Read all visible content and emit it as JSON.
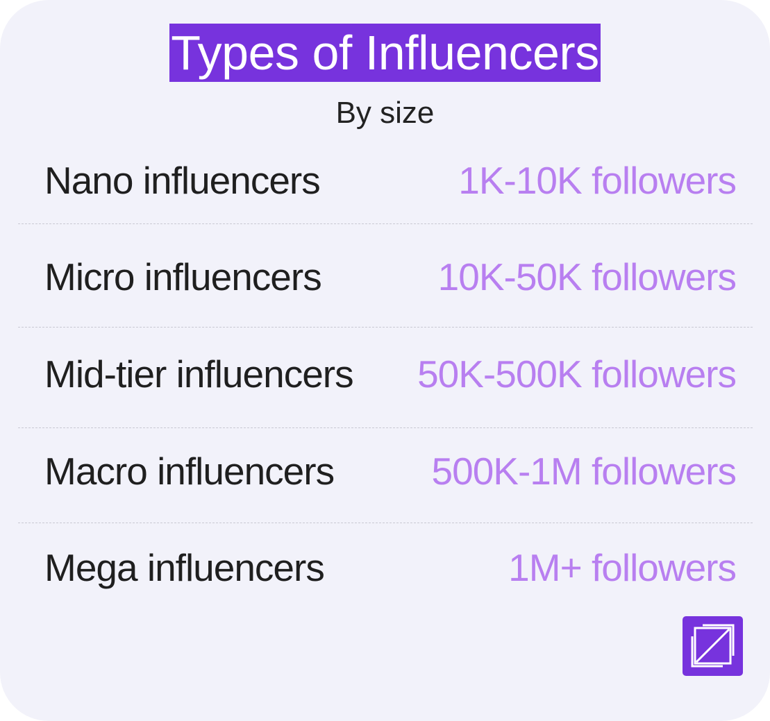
{
  "header": {
    "title": "Types of Influencers",
    "subtitle": "By size"
  },
  "rows": [
    {
      "label": "Nano influencers",
      "value": "1K-10K followers"
    },
    {
      "label": "Micro influencers",
      "value": "10K-50K followers"
    },
    {
      "label": "Mid-tier influencers",
      "value": "50K-500K followers"
    },
    {
      "label": "Macro influencers",
      "value": "500K-1M followers"
    },
    {
      "label": "Mega influencers",
      "value": "1M+ followers"
    }
  ],
  "colors": {
    "accent": "#7733dd",
    "value_text": "#b87ff0",
    "background": "#f2f2fa"
  },
  "logo": {
    "icon": "brand-logo-icon"
  }
}
